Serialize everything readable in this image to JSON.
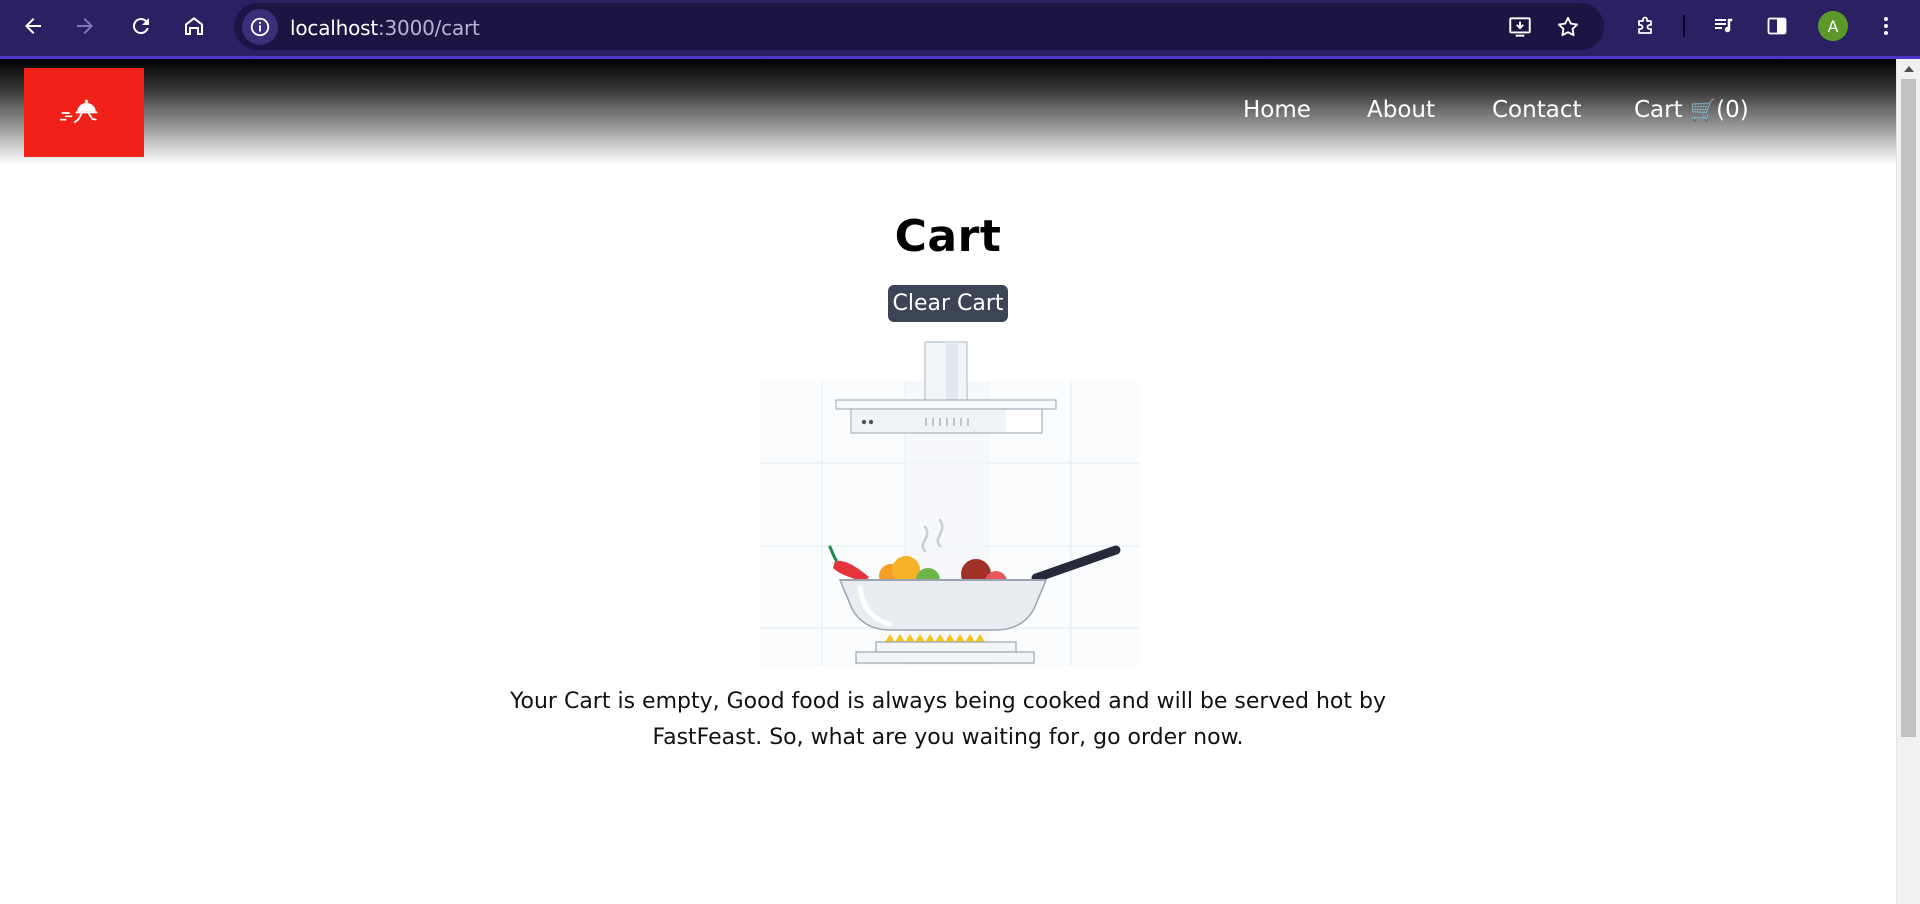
{
  "browser": {
    "url_host": "localhost",
    "url_rest": ":3000/cart",
    "avatar_letter": "A",
    "icons": {
      "back": "arrow-left-icon",
      "forward": "arrow-right-icon",
      "reload": "reload-icon",
      "home": "home-icon",
      "site_info": "info-icon",
      "install": "install-app-icon",
      "bookmark": "star-icon",
      "extensions": "puzzle-icon",
      "media": "media-queue-icon",
      "side_panel": "side-panel-icon",
      "menu": "kebab-menu-icon"
    },
    "colors": {
      "toolbar": "#2b2062",
      "accent": "#4a35c8"
    }
  },
  "navbar": {
    "logo_icon": "food-delivery-cloche-icon",
    "links": {
      "home": "Home",
      "about": "About",
      "contact": "Contact",
      "cart_label": "Cart",
      "cart_icon": "🛒",
      "cart_count": "(0)"
    },
    "colors": {
      "logo_bg": "#f02119"
    }
  },
  "cart": {
    "title": "Cart",
    "clear_button": "Clear Cart",
    "illustration": "cooking-pan-illustration",
    "empty_message": "Your Cart is empty, Good food is always being cooked and will be served hot by FastFeast. So, what are you waiting for, go order now."
  }
}
